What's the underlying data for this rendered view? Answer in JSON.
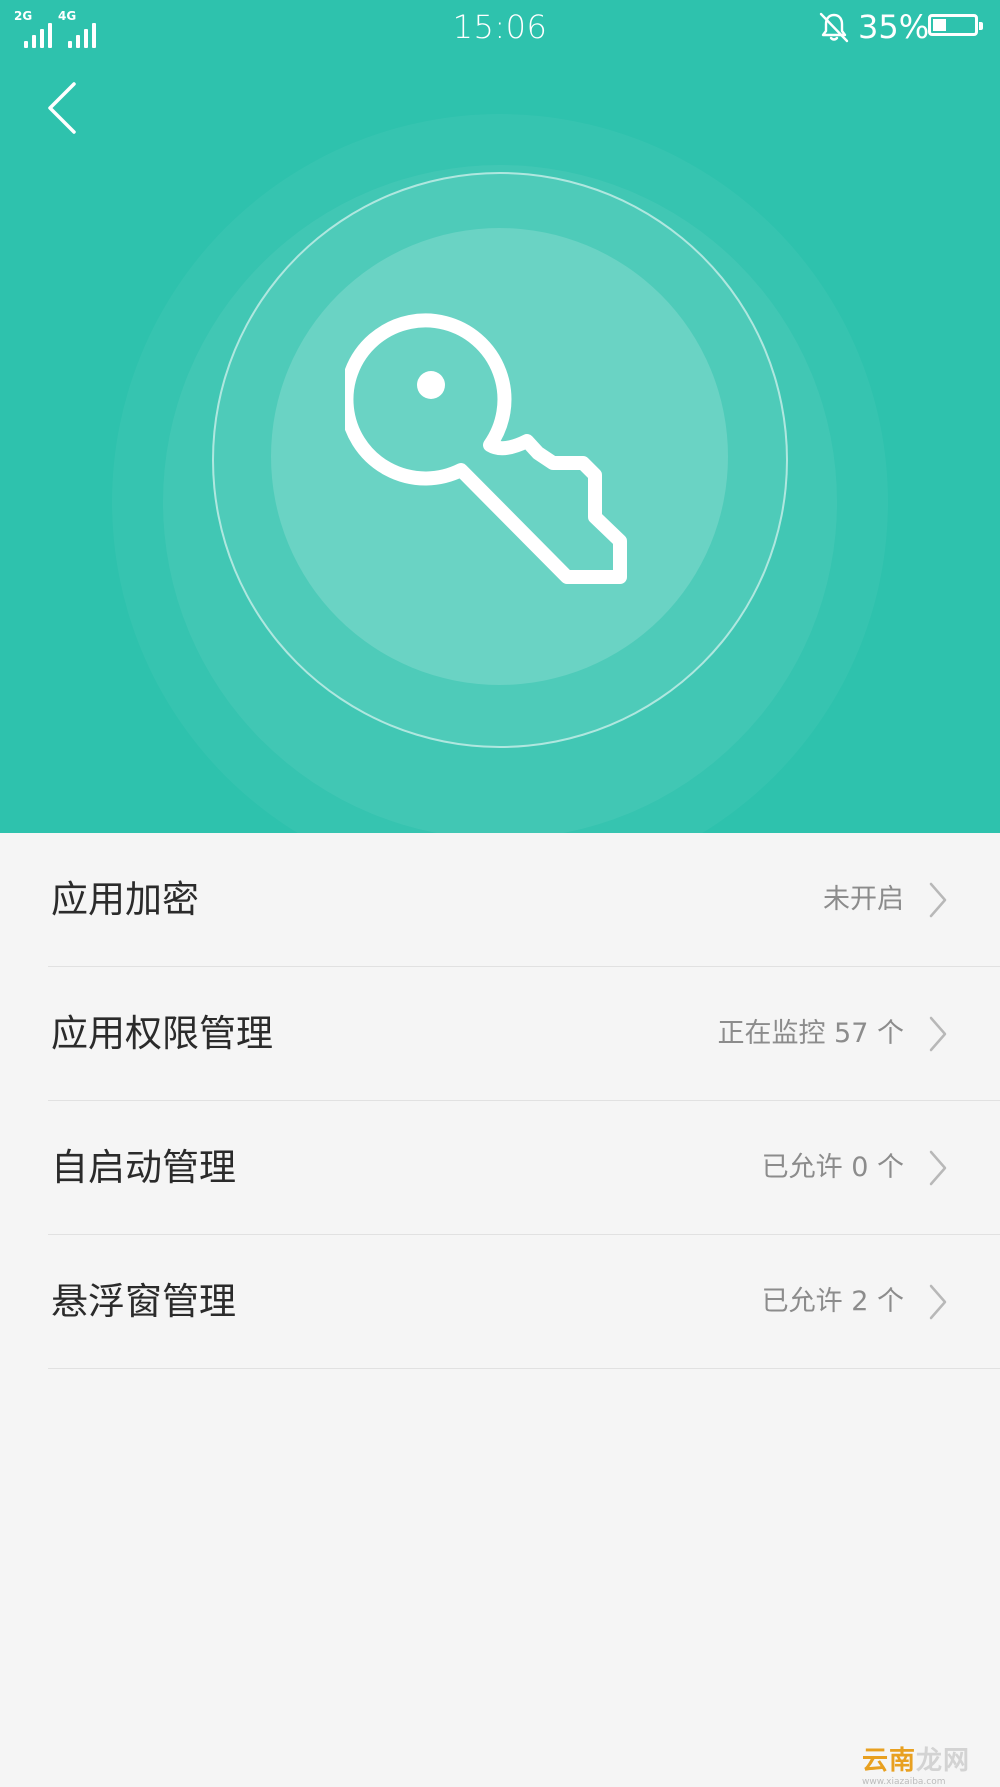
{
  "status_bar": {
    "signal_1_label": "2G",
    "signal_2_label": "4G",
    "time": "15:06",
    "battery_percent": "35%",
    "battery_level": 0.35,
    "notifications_muted": true
  },
  "header": {
    "back_icon": "chevron-left-icon",
    "hero_icon": "key-icon"
  },
  "items": [
    {
      "label": "应用加密",
      "value": "未开启"
    },
    {
      "label": "应用权限管理",
      "value": "正在监控 57 个"
    },
    {
      "label": "自启动管理",
      "value": "已允许 0 个"
    },
    {
      "label": "悬浮窗管理",
      "value": "已允许 2 个"
    }
  ],
  "watermark": {
    "text_accent": "云南",
    "text_rest": "龙网",
    "sub": "www.xiazaiba.com"
  },
  "colors": {
    "accent": "#2ec2ad",
    "background": "#f5f5f5",
    "label": "#2b2b2b",
    "value": "#8c8c8c"
  }
}
